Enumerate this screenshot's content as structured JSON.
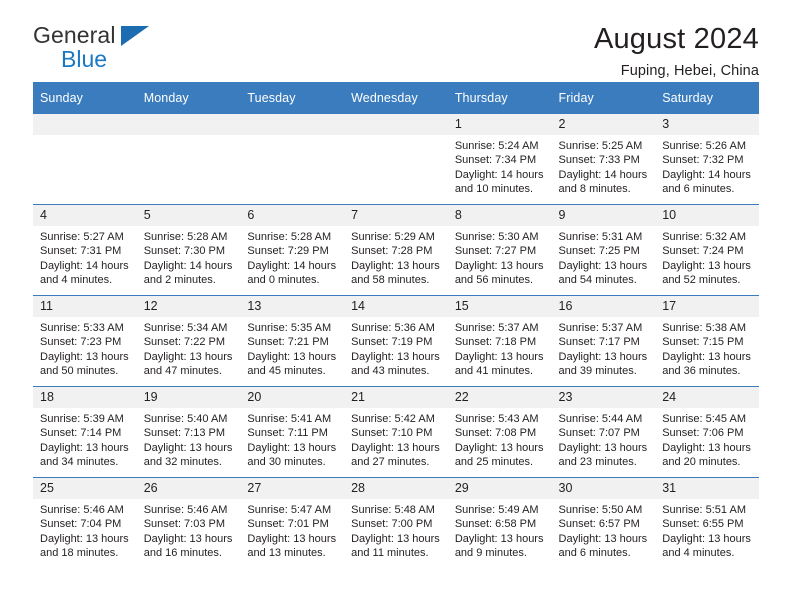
{
  "brand": {
    "name_line1": "General",
    "name_line2": "Blue",
    "accent_color": "#1b79c2"
  },
  "header": {
    "title": "August 2024",
    "subtitle": "Fuping, Hebei, China"
  },
  "calendar": {
    "header_bg": "#3a7cbe",
    "daynum_bg": "#f1f1f1",
    "weekdays": [
      "Sunday",
      "Monday",
      "Tuesday",
      "Wednesday",
      "Thursday",
      "Friday",
      "Saturday"
    ],
    "weeks": [
      [
        {
          "day": "",
          "lines": []
        },
        {
          "day": "",
          "lines": []
        },
        {
          "day": "",
          "lines": []
        },
        {
          "day": "",
          "lines": []
        },
        {
          "day": "1",
          "lines": [
            "Sunrise: 5:24 AM",
            "Sunset: 7:34 PM",
            "Daylight: 14 hours",
            "and 10 minutes."
          ]
        },
        {
          "day": "2",
          "lines": [
            "Sunrise: 5:25 AM",
            "Sunset: 7:33 PM",
            "Daylight: 14 hours",
            "and 8 minutes."
          ]
        },
        {
          "day": "3",
          "lines": [
            "Sunrise: 5:26 AM",
            "Sunset: 7:32 PM",
            "Daylight: 14 hours",
            "and 6 minutes."
          ]
        }
      ],
      [
        {
          "day": "4",
          "lines": [
            "Sunrise: 5:27 AM",
            "Sunset: 7:31 PM",
            "Daylight: 14 hours",
            "and 4 minutes."
          ]
        },
        {
          "day": "5",
          "lines": [
            "Sunrise: 5:28 AM",
            "Sunset: 7:30 PM",
            "Daylight: 14 hours",
            "and 2 minutes."
          ]
        },
        {
          "day": "6",
          "lines": [
            "Sunrise: 5:28 AM",
            "Sunset: 7:29 PM",
            "Daylight: 14 hours",
            "and 0 minutes."
          ]
        },
        {
          "day": "7",
          "lines": [
            "Sunrise: 5:29 AM",
            "Sunset: 7:28 PM",
            "Daylight: 13 hours",
            "and 58 minutes."
          ]
        },
        {
          "day": "8",
          "lines": [
            "Sunrise: 5:30 AM",
            "Sunset: 7:27 PM",
            "Daylight: 13 hours",
            "and 56 minutes."
          ]
        },
        {
          "day": "9",
          "lines": [
            "Sunrise: 5:31 AM",
            "Sunset: 7:25 PM",
            "Daylight: 13 hours",
            "and 54 minutes."
          ]
        },
        {
          "day": "10",
          "lines": [
            "Sunrise: 5:32 AM",
            "Sunset: 7:24 PM",
            "Daylight: 13 hours",
            "and 52 minutes."
          ]
        }
      ],
      [
        {
          "day": "11",
          "lines": [
            "Sunrise: 5:33 AM",
            "Sunset: 7:23 PM",
            "Daylight: 13 hours",
            "and 50 minutes."
          ]
        },
        {
          "day": "12",
          "lines": [
            "Sunrise: 5:34 AM",
            "Sunset: 7:22 PM",
            "Daylight: 13 hours",
            "and 47 minutes."
          ]
        },
        {
          "day": "13",
          "lines": [
            "Sunrise: 5:35 AM",
            "Sunset: 7:21 PM",
            "Daylight: 13 hours",
            "and 45 minutes."
          ]
        },
        {
          "day": "14",
          "lines": [
            "Sunrise: 5:36 AM",
            "Sunset: 7:19 PM",
            "Daylight: 13 hours",
            "and 43 minutes."
          ]
        },
        {
          "day": "15",
          "lines": [
            "Sunrise: 5:37 AM",
            "Sunset: 7:18 PM",
            "Daylight: 13 hours",
            "and 41 minutes."
          ]
        },
        {
          "day": "16",
          "lines": [
            "Sunrise: 5:37 AM",
            "Sunset: 7:17 PM",
            "Daylight: 13 hours",
            "and 39 minutes."
          ]
        },
        {
          "day": "17",
          "lines": [
            "Sunrise: 5:38 AM",
            "Sunset: 7:15 PM",
            "Daylight: 13 hours",
            "and 36 minutes."
          ]
        }
      ],
      [
        {
          "day": "18",
          "lines": [
            "Sunrise: 5:39 AM",
            "Sunset: 7:14 PM",
            "Daylight: 13 hours",
            "and 34 minutes."
          ]
        },
        {
          "day": "19",
          "lines": [
            "Sunrise: 5:40 AM",
            "Sunset: 7:13 PM",
            "Daylight: 13 hours",
            "and 32 minutes."
          ]
        },
        {
          "day": "20",
          "lines": [
            "Sunrise: 5:41 AM",
            "Sunset: 7:11 PM",
            "Daylight: 13 hours",
            "and 30 minutes."
          ]
        },
        {
          "day": "21",
          "lines": [
            "Sunrise: 5:42 AM",
            "Sunset: 7:10 PM",
            "Daylight: 13 hours",
            "and 27 minutes."
          ]
        },
        {
          "day": "22",
          "lines": [
            "Sunrise: 5:43 AM",
            "Sunset: 7:08 PM",
            "Daylight: 13 hours",
            "and 25 minutes."
          ]
        },
        {
          "day": "23",
          "lines": [
            "Sunrise: 5:44 AM",
            "Sunset: 7:07 PM",
            "Daylight: 13 hours",
            "and 23 minutes."
          ]
        },
        {
          "day": "24",
          "lines": [
            "Sunrise: 5:45 AM",
            "Sunset: 7:06 PM",
            "Daylight: 13 hours",
            "and 20 minutes."
          ]
        }
      ],
      [
        {
          "day": "25",
          "lines": [
            "Sunrise: 5:46 AM",
            "Sunset: 7:04 PM",
            "Daylight: 13 hours",
            "and 18 minutes."
          ]
        },
        {
          "day": "26",
          "lines": [
            "Sunrise: 5:46 AM",
            "Sunset: 7:03 PM",
            "Daylight: 13 hours",
            "and 16 minutes."
          ]
        },
        {
          "day": "27",
          "lines": [
            "Sunrise: 5:47 AM",
            "Sunset: 7:01 PM",
            "Daylight: 13 hours",
            "and 13 minutes."
          ]
        },
        {
          "day": "28",
          "lines": [
            "Sunrise: 5:48 AM",
            "Sunset: 7:00 PM",
            "Daylight: 13 hours",
            "and 11 minutes."
          ]
        },
        {
          "day": "29",
          "lines": [
            "Sunrise: 5:49 AM",
            "Sunset: 6:58 PM",
            "Daylight: 13 hours",
            "and 9 minutes."
          ]
        },
        {
          "day": "30",
          "lines": [
            "Sunrise: 5:50 AM",
            "Sunset: 6:57 PM",
            "Daylight: 13 hours",
            "and 6 minutes."
          ]
        },
        {
          "day": "31",
          "lines": [
            "Sunrise: 5:51 AM",
            "Sunset: 6:55 PM",
            "Daylight: 13 hours",
            "and 4 minutes."
          ]
        }
      ]
    ]
  }
}
